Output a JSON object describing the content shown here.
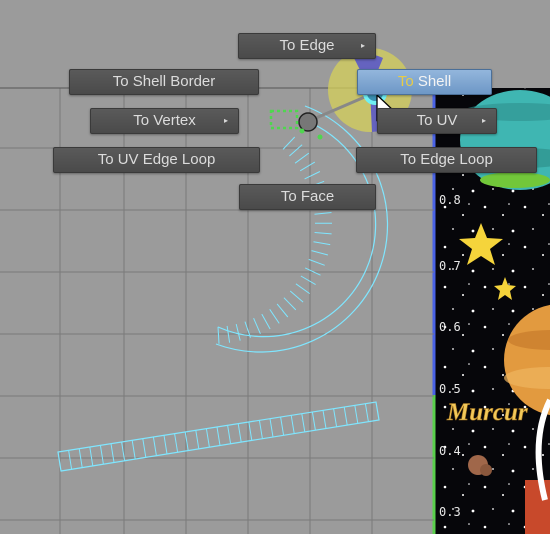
{
  "marking_menu": {
    "to_edge": "To Edge",
    "to_shell_border": "To Shell Border",
    "to_shell_prefix": "To",
    "to_shell_suffix": " Shell",
    "to_vertex": "To Vertex",
    "to_uv": "To UV",
    "to_uv_edge_loop": "To UV Edge Loop",
    "to_edge_loop": "To Edge Loop",
    "to_face": "To Face",
    "submenu_marker": "▸",
    "active_item": "To Shell"
  },
  "uv_axis_labels": [
    "0.8",
    "0.7",
    "0.6",
    "0.5",
    "0.4",
    "0.3"
  ],
  "texture": {
    "visible_text": "Murcur"
  },
  "colors": {
    "viewport_bg": "#9b9b9b",
    "grid_line": "#777777",
    "uv_wire": "#7fe6ff",
    "selection_green": "#4fd64f",
    "menu_bg": "#4f4f4f",
    "menu_active": "#7aa3d0",
    "menu_text": "#dcdcdc",
    "texture_border": "#4a63e6"
  }
}
